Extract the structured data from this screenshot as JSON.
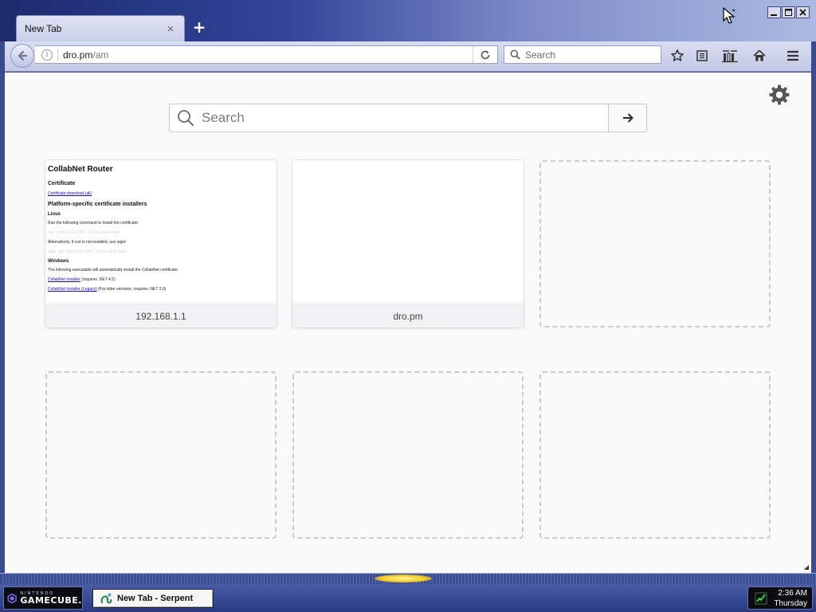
{
  "browser": {
    "tab": {
      "title": "New Tab",
      "close_glyph": "×"
    },
    "new_tab_glyph": "+",
    "url": {
      "host": "dro.pm",
      "path": "/am"
    },
    "search_placeholder": "Search",
    "icons": [
      "back-arrow-icon",
      "info-icon",
      "reload-icon",
      "search-icon",
      "bookmark-star-icon",
      "reader-view-icon",
      "library-icon",
      "home-icon",
      "hamburger-menu-icon"
    ]
  },
  "newtab": {
    "search_placeholder": "Search",
    "tiles": [
      {
        "label": "192.168.1.1",
        "preview": {
          "title": "CollabNet Router",
          "section_certificate": "Certificate",
          "certificate_link": "Certificate download (all)",
          "section_platform": "Platform-specific certificate installers",
          "section_linux": "Linux",
          "linux_text_1": "Run the following command to install the certificate:",
          "linux_faint_1": "curl -s http://192.168.1.1/cert | sudo bash",
          "linux_text_2": "Alternatively, if curl is not installed, use wget:",
          "linux_faint_2": "wget -qO- http://192.168.1.1/cert | sudo bash",
          "section_windows": "Windows",
          "windows_text": "The following executable will automatically install the CollabNet certificate:",
          "installer_link_1": "CollabNet Installer",
          "installer_note_1": "(requires .NET 4.5)",
          "installer_link_2": "CollabNet Installer (Legacy)",
          "installer_note_2": "(For older versions, requires .NET 2.0)"
        }
      },
      {
        "label": "dro.pm"
      }
    ]
  },
  "window": {
    "controls": [
      "minimize",
      "maximize",
      "close"
    ]
  },
  "taskbar": {
    "start_top": "NINTENDO",
    "start_main": "GAMECUBE.",
    "task_item": "New Tab - Serpent",
    "time": "2:36 AM",
    "day": "Thursday"
  },
  "colors": {
    "title_gradient": [
      "#1c2a6e",
      "#aeb9e2"
    ],
    "taskbar": "#2a3a82",
    "content_bg": "#f9f9fa",
    "tray_glow": "#f2cc1f"
  }
}
